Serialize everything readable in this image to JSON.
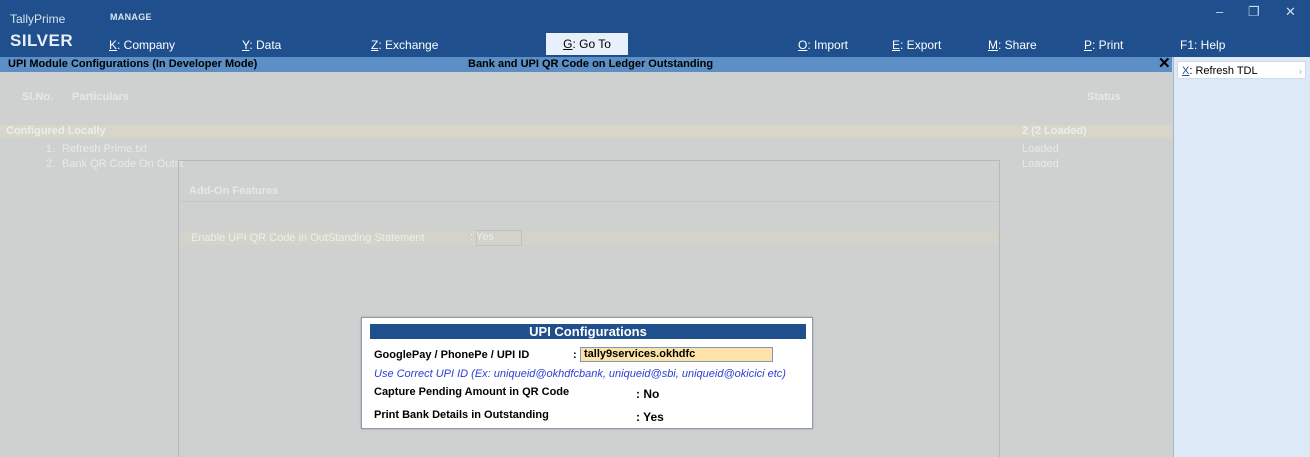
{
  "app": {
    "brand": "TallyPrime",
    "edition": "SILVER",
    "manage_label": "MANAGE"
  },
  "menu": [
    {
      "key": "K",
      "label": ": Company"
    },
    {
      "key": "Y",
      "label": ": Data"
    },
    {
      "key": "Z",
      "label": ": Exchange"
    },
    {
      "key": "G",
      "label": ": Go To"
    },
    {
      "key": "O",
      "label": ": Import"
    },
    {
      "key": "E",
      "label": ": Export"
    },
    {
      "key": "M",
      "label": ": Share"
    },
    {
      "key": "P",
      "label": ": Print"
    },
    {
      "key": "F1",
      "label": ": Help"
    }
  ],
  "window_controls": {
    "minimize": "–",
    "restore": "❐",
    "close": "✕"
  },
  "title_bar": {
    "left": "UPI Module Configurations (In Developer Mode)",
    "center": "Bank and UPI QR Code on Ledger Outstanding",
    "close": "✕"
  },
  "right_panel": {
    "refresh": {
      "key": "X",
      "label": ": Refresh TDL"
    }
  },
  "table": {
    "headers": {
      "slno": "Sl.No.",
      "particulars": "Particulars",
      "status": "Status"
    },
    "section": {
      "label": "Configured Locally",
      "count": "2 (2 Loaded)"
    },
    "rows": [
      {
        "num": "1.",
        "name": "Refresh Prime.txt",
        "status": "Loaded"
      },
      {
        "num": "2.",
        "name": "Bank QR Code On Outst",
        "status": "Loaded"
      }
    ]
  },
  "addon": {
    "title": "Add-On Features",
    "enable_label": "Enable UPI QR Code in OutStanding Statement",
    "enable_value": ": Yes"
  },
  "modal": {
    "title": "UPI Configurations",
    "upi_label": "GooglePay / PhonePe / UPI ID",
    "upi_colon": ":",
    "upi_value": "tally9services.okhdfc",
    "hint": "Use Correct UPI ID (Ex: uniqueid@okhdfcbank, uniqueid@sbi, uniqueid@okicici etc)",
    "capture_label": "Capture Pending Amount in QR Code",
    "capture_value": ": No",
    "print_label": "Print Bank Details in Outstanding",
    "print_value": ": Yes"
  },
  "colors": {
    "topbar": "#1f4f8c",
    "titlebar": "#5b8fc6",
    "input_bg": "#fde3a8",
    "hint": "#2a3fd3"
  }
}
